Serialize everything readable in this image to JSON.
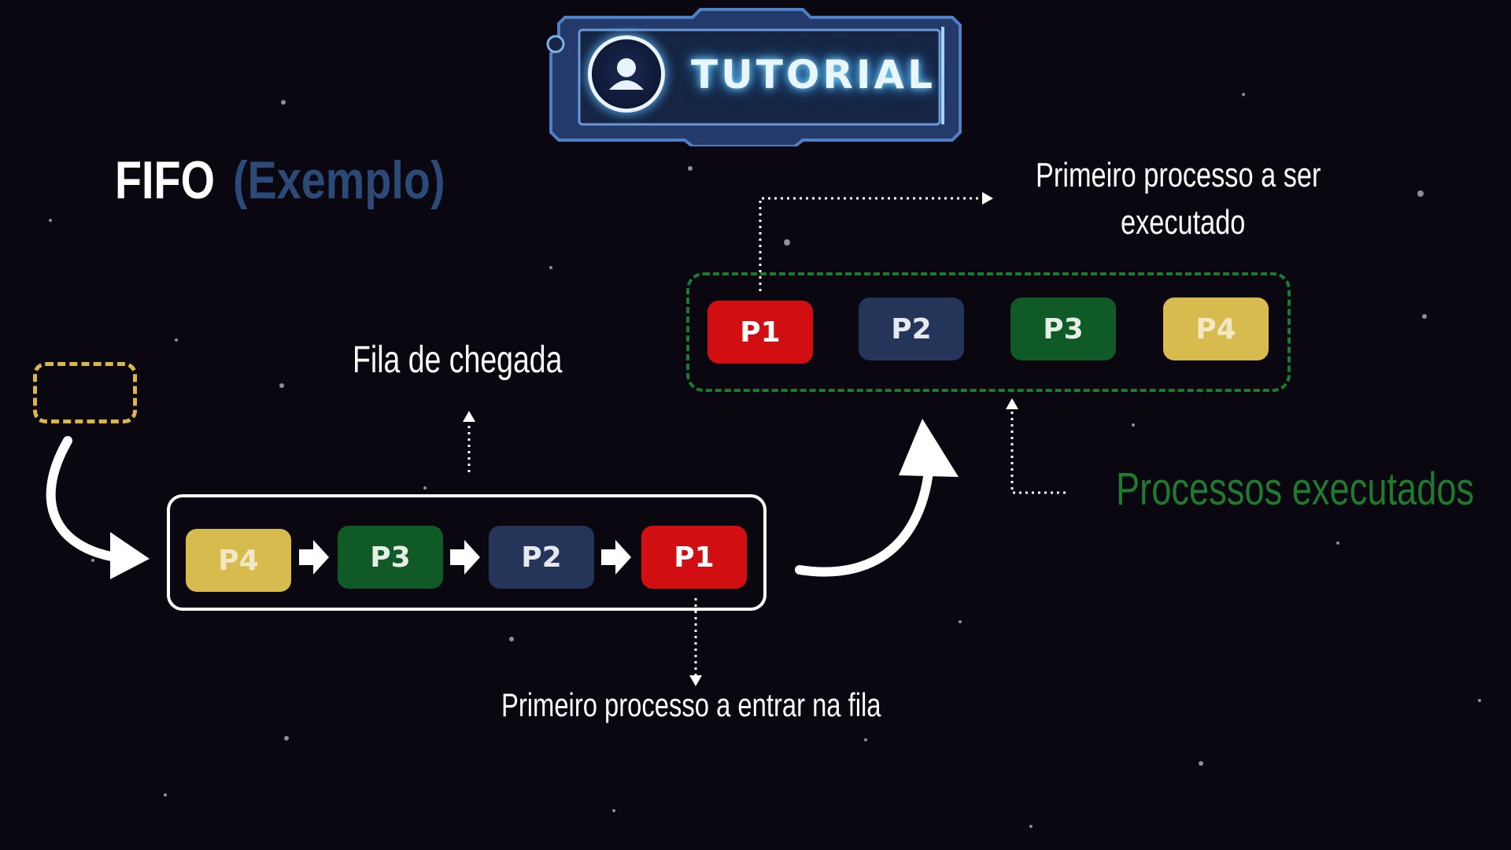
{
  "badge": {
    "label": "TUTORIAL",
    "icon": "user-icon"
  },
  "title": {
    "main": "FIFO",
    "sub": "(Exemplo)"
  },
  "labels": {
    "arrival_queue": "Fila de chegada",
    "first_to_execute_line1": "Primeiro processo a ser",
    "first_to_execute_line2": "executado",
    "first_in_queue": "Primeiro processo a entrar na fila",
    "executed": "Processos executados"
  },
  "queue": [
    {
      "label": "P4",
      "color": "#d8bb4f"
    },
    {
      "label": "P3",
      "color": "#0f5a27"
    },
    {
      "label": "P2",
      "color": "#25355a"
    },
    {
      "label": "P1",
      "color": "#d10f12"
    }
  ],
  "executed": [
    {
      "label": "P1",
      "color": "#d10f12"
    },
    {
      "label": "P2",
      "color": "#25355a"
    },
    {
      "label": "P3",
      "color": "#0f5a27"
    },
    {
      "label": "P4",
      "color": "#d8bb4f"
    }
  ],
  "colors": {
    "background": "#0a0710",
    "executed_border": "#1a7a2e",
    "new_slot_border": "#d8b84a",
    "subtitle": "#2c4a78"
  }
}
